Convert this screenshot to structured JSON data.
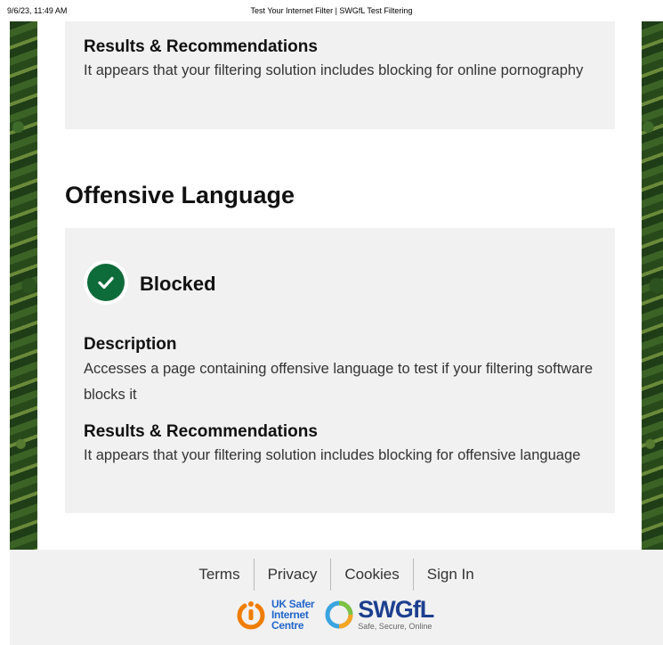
{
  "print_header": {
    "date": "9/6/23, 11:49 AM",
    "title": "Test Your Internet Filter | SWGfL Test Filtering"
  },
  "card_top": {
    "results_heading": "Results & Recommendations",
    "results_text": "It appears that your filtering solution includes blocking for online pornography"
  },
  "section": {
    "title": "Offensive Language",
    "status": "Blocked",
    "status_icon": "check-circle-icon",
    "status_color": "#0e6b3a",
    "description_heading": "Description",
    "description_text": "Accesses a page containing offensive language to test if your filtering software blocks it",
    "results_heading": "Results & Recommendations",
    "results_text": "It appears that your filtering solution includes blocking for offensive language"
  },
  "footer": {
    "links": [
      "Terms",
      "Privacy",
      "Cookies",
      "Sign In"
    ],
    "ukc_logo": [
      "UK Safer",
      "Internet",
      "Centre"
    ],
    "swgfl_logo": "SWGfL",
    "swgfl_tagline": "Safe, Secure, Online"
  }
}
